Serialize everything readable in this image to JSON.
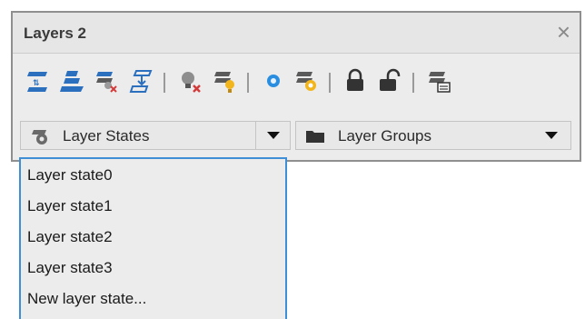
{
  "window": {
    "title": "Layers 2",
    "close_glyph": "×"
  },
  "toolbar": {
    "buttons": [
      {
        "name": "set-current-layer-icon"
      },
      {
        "name": "match-layer-icon"
      },
      {
        "name": "isolate-layer-icon"
      },
      {
        "name": "previous-layer-icon"
      },
      {
        "name": "layer-off-icon"
      },
      {
        "name": "turn-all-layers-on-icon"
      },
      {
        "name": "freeze-layer-icon"
      },
      {
        "name": "thaw-all-layers-icon"
      },
      {
        "name": "lock-layer-icon"
      },
      {
        "name": "unlock-layer-icon"
      },
      {
        "name": "layer-properties-icon"
      }
    ]
  },
  "states_combo": {
    "label": "Layer States",
    "icon": "layer-states-gear-icon"
  },
  "groups_combo": {
    "label": "Layer Groups",
    "icon": "folder-icon"
  },
  "dropdown": {
    "items": [
      "Layer state0",
      "Layer state1",
      "Layer state2",
      "Layer state3",
      "New layer state..."
    ]
  },
  "colors": {
    "accent_blue": "#2b6fbf",
    "dropdown_border": "#3e8fd6",
    "bulb_yellow": "#f2b51c",
    "red_x": "#d23a3a"
  }
}
